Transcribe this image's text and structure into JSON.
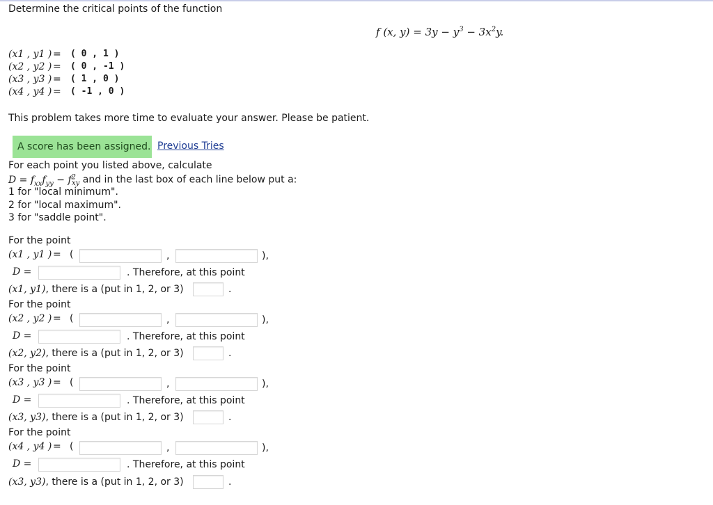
{
  "problem": {
    "title": "Determine the critical points of the function",
    "function_lhs": "f (x, y) = 3y − y",
    "function_exp": "3",
    "function_mid": " − 3x",
    "function_exp2": "2",
    "function_tail": "y."
  },
  "critical_points": [
    {
      "label": "(x1 , y1 )",
      "value": "( 0 , 1 )"
    },
    {
      "label": "(x2 , y2 )",
      "value": "( 0 , -1 )"
    },
    {
      "label": "(x3 , y3 )",
      "value": "( 1 , 0 )"
    },
    {
      "label": "(x4 , y4 )",
      "value": "( -1 , 0 )"
    }
  ],
  "equals": "=",
  "notice": "This problem takes more time to evaluate your answer. Please be patient.",
  "status": {
    "badge": "A score has been assigned.",
    "link": "Previous Tries"
  },
  "instructions": {
    "line1": "For each point you listed above, calculate",
    "line2_tail": "and in the last box of each line below put a:",
    "opt1": "1 for \"local minimum\".",
    "opt2": "2 for \"local maximum\".",
    "opt3": "3 for \"saddle point\"."
  },
  "groups": [
    {
      "for_label": "For the point",
      "point_label": "(x1 , y1 )",
      "tuple_open": "(",
      "comma": ",",
      "tuple_close": "),",
      "d_label": "D =",
      "therefore": ". Therefore, at this point",
      "point_ref": "(x1, y1)",
      "question": ", there is a (put in 1, 2, or 3)",
      "period": ".",
      "x_value": "",
      "y_value": "",
      "d_value": "",
      "type_value": ""
    },
    {
      "for_label": "For the point",
      "point_label": "(x2 , y2 )",
      "tuple_open": "(",
      "comma": ",",
      "tuple_close": "),",
      "d_label": "D =",
      "therefore": ". Therefore, at this point",
      "point_ref": "(x2, y2)",
      "question": ", there is a (put in 1, 2, or 3)",
      "period": ".",
      "x_value": "",
      "y_value": "",
      "d_value": "",
      "type_value": ""
    },
    {
      "for_label": "For the point",
      "point_label": "(x3 , y3 )",
      "tuple_open": "(",
      "comma": ",",
      "tuple_close": "),",
      "d_label": "D =",
      "therefore": ". Therefore, at this point",
      "point_ref": "(x3, y3)",
      "question": ", there is a (put in 1, 2, or 3)",
      "period": ".",
      "x_value": "",
      "y_value": "",
      "d_value": "",
      "type_value": ""
    },
    {
      "for_label": "For the point",
      "point_label": "(x4 , y4 )",
      "tuple_open": "(",
      "comma": ",",
      "tuple_close": "),",
      "d_label": "D =",
      "therefore": ". Therefore, at this point",
      "point_ref": "(x3, y3)",
      "question": ", there is a (put in 1, 2, or 3)",
      "period": ".",
      "x_value": "",
      "y_value": "",
      "d_value": "",
      "type_value": ""
    }
  ],
  "colors": {
    "badge_bg": "#9be396",
    "link": "#1f3d94"
  }
}
